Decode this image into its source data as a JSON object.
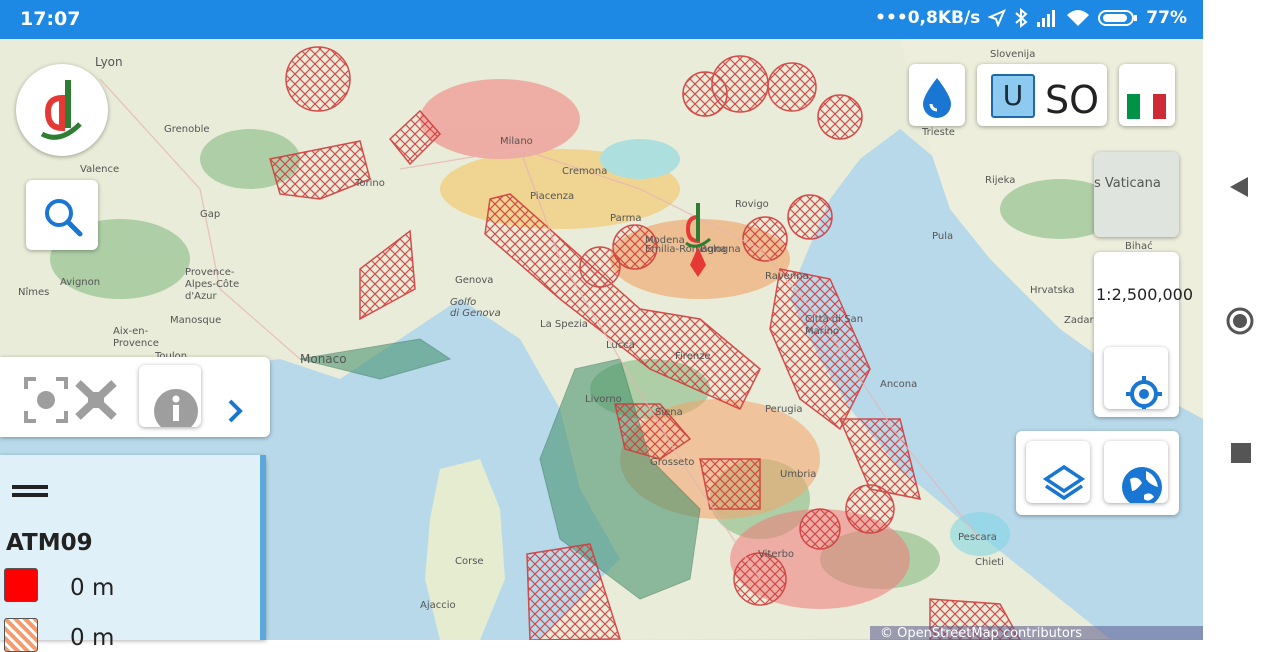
{
  "status_bar": {
    "time": "17:07",
    "network_speed": "0,8KB/s",
    "battery": "77%",
    "icons": [
      "location-icon",
      "bluetooth-icon",
      "signal-icon",
      "wifi-icon",
      "battery-icon"
    ]
  },
  "map": {
    "scale": "1:2,500,000",
    "attribution": "© OpenStreetMap contributors",
    "labels": [
      {
        "text": "Lyon"
      },
      {
        "text": "Grenoble"
      },
      {
        "text": "Valence"
      },
      {
        "text": "Gap"
      },
      {
        "text": "Provence-\nAlpes-Côte\nd'Azur"
      },
      {
        "text": "Avignon"
      },
      {
        "text": "Nîmes"
      },
      {
        "text": "Manosque"
      },
      {
        "text": "Aix-en-\nProvence"
      },
      {
        "text": "Toulon"
      },
      {
        "text": "Monaco"
      },
      {
        "text": "Torino"
      },
      {
        "text": "Milano"
      },
      {
        "text": "Genova"
      },
      {
        "text": "Golfo\ndi Genova"
      },
      {
        "text": "Cremona"
      },
      {
        "text": "Piacenza"
      },
      {
        "text": "Parma"
      },
      {
        "text": "Modena"
      },
      {
        "text": "Bologna"
      },
      {
        "text": "Emilia-Romagna"
      },
      {
        "text": "Ravenna"
      },
      {
        "text": "Rovigo"
      },
      {
        "text": "La Spezia"
      },
      {
        "text": "Lucca"
      },
      {
        "text": "Firenze"
      },
      {
        "text": "Livorno"
      },
      {
        "text": "Grosseto"
      },
      {
        "text": "Siena"
      },
      {
        "text": "Perugia"
      },
      {
        "text": "Umbria"
      },
      {
        "text": "Viterbo"
      },
      {
        "text": "Ancona"
      },
      {
        "text": "Città di San\nMarino"
      },
      {
        "text": "Pescara"
      },
      {
        "text": "Chieti"
      },
      {
        "text": "Corse"
      },
      {
        "text": "Ajaccio"
      },
      {
        "text": "Trieste"
      },
      {
        "text": "Slovenija"
      },
      {
        "text": "Rijeka"
      },
      {
        "text": "Pula"
      },
      {
        "text": "Hrvatska"
      },
      {
        "text": "Zadar"
      },
      {
        "text": "Bihać"
      }
    ]
  },
  "controls": {
    "water_icon": "water-drop-icon",
    "uso_box": "U",
    "uso_text": "SO",
    "flag_icon": "italy-flag-icon",
    "basemap_thumb_label": "s Vaticana",
    "locate_icon": "gps-target-icon",
    "layers_icon": "layers-icon",
    "globe_icon": "globe-icon",
    "search_icon": "search-icon",
    "scan_icon": "drone-scan-icon",
    "info_icon": "info-icon",
    "chevron_icon": "chevron-right-icon"
  },
  "legend": {
    "menu_icon": "drag-handle-icon",
    "title": "ATM09",
    "items": [
      {
        "label": "0 m",
        "color": "#ff0000"
      },
      {
        "label": "0 m",
        "color": "#f59a6c"
      }
    ]
  },
  "colors": {
    "status_bar": "#1e88e5",
    "accent": "#1976d2",
    "sea": "#b8d9ea",
    "zone_red": "#e53935",
    "zone_green": "#3f8f6a"
  }
}
